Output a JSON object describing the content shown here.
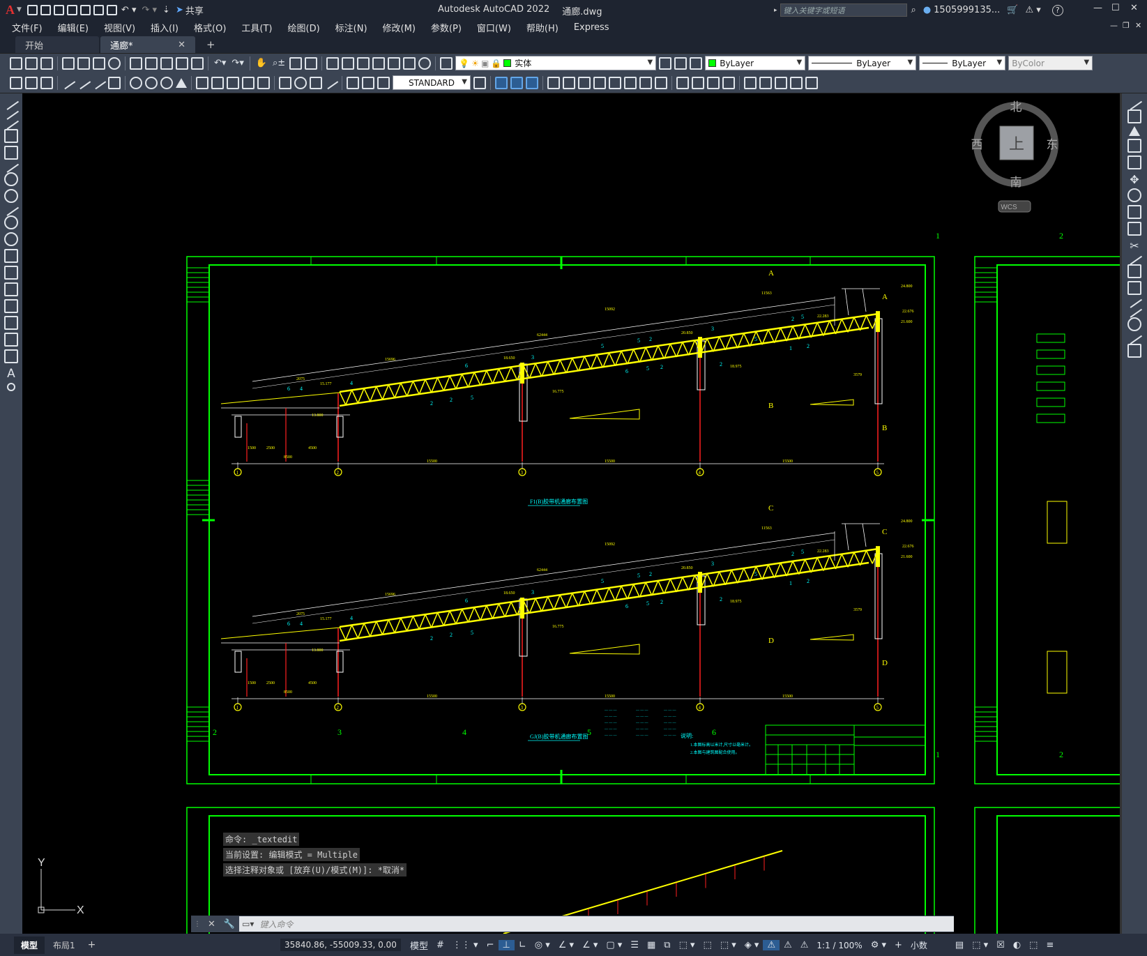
{
  "app": {
    "title": "Autodesk AutoCAD 2022",
    "filename": "通廊.dwg",
    "share_label": "共享",
    "search_placeholder": "键入关键字或短语",
    "user": "1505999135...",
    "help": "?"
  },
  "menu": [
    "文件(F)",
    "编辑(E)",
    "视图(V)",
    "插入(I)",
    "格式(O)",
    "工具(T)",
    "绘图(D)",
    "标注(N)",
    "修改(M)",
    "参数(P)",
    "窗口(W)",
    "帮助(H)",
    "Express"
  ],
  "tabs": [
    {
      "label": "开始"
    },
    {
      "label": "通廊*"
    }
  ],
  "layer": {
    "name": "实体",
    "color": "#00ff00"
  },
  "properties": {
    "color": "ByLayer",
    "linetype": "ByLayer",
    "lineweight": "ByLayer",
    "plotstyle": "ByColor"
  },
  "text_style": "STANDARD",
  "viewcube": {
    "north": "北",
    "south": "南",
    "east": "东",
    "west": "西",
    "top": "上",
    "wcs": "WCS"
  },
  "drawing": {
    "colors": {
      "frame": "#00ff00",
      "truss": "#ffff00",
      "red": "#ff2020",
      "cyan": "#00ffff",
      "white": "#ffffff",
      "blue": "#4040ff"
    },
    "plan1": {
      "span": "15500",
      "total": "62444",
      "grid_labels": [
        "1",
        "2",
        "1",
        "2",
        "3"
      ],
      "zones": [
        "A",
        "B"
      ],
      "title": "F1(B)胶带机通廊布置图",
      "elev": [
        "13.800",
        "15.177",
        "18.650",
        "16.775",
        "20.850",
        "18.975",
        "22.283",
        "21.600",
        "22.676",
        "24.800"
      ]
    },
    "plan2": {
      "zones": [
        "C",
        "D"
      ],
      "title": "GJ(B)胶带机通廊布置图"
    },
    "border_numbers": [
      "1",
      "2",
      "2",
      "3",
      "4",
      "5",
      "6",
      "1",
      "2"
    ],
    "notes_title": "说明:",
    "notes": [
      "1.本图标高以米计,尺寸以毫米计。",
      "2.本图与建筑图配合使用。"
    ]
  },
  "command": {
    "history": [
      "命令: _textedit",
      "当前设置: 编辑模式 = Multiple",
      "选择注释对象或 [放弃(U)/模式(M)]: *取消*"
    ],
    "placeholder": "键入命令"
  },
  "status": {
    "model_tab": "模型",
    "layout_tab": "布局1",
    "coords": "35840.86, -55009.33, 0.00",
    "space": "模型",
    "scale": "1:1 / 100%",
    "units": "小数"
  },
  "ucs": {
    "x": "X",
    "y": "Y"
  }
}
